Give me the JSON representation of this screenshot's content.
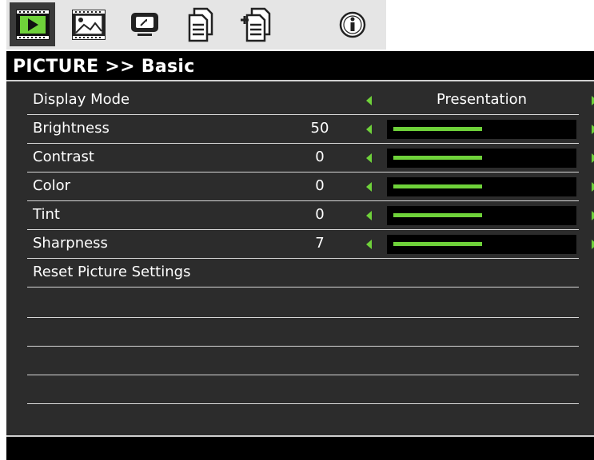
{
  "colors": {
    "accent": "#6fd23a",
    "header_bg": "#000000",
    "panel_bg": "#2c2c2c",
    "tabbar_bg": "#e5e5e5"
  },
  "tabs": [
    {
      "icon": "picture-play-icon",
      "active": true
    },
    {
      "icon": "image-adjust-icon",
      "active": false
    },
    {
      "icon": "display-icon",
      "active": false
    },
    {
      "icon": "document-setup-icon",
      "active": false
    },
    {
      "icon": "document-options-icon",
      "active": false
    },
    {
      "icon": "info-icon",
      "active": false
    }
  ],
  "header": {
    "title": "PICTURE >> Basic"
  },
  "menu": {
    "display_mode": {
      "label": "Display Mode",
      "option": "Presentation"
    },
    "brightness": {
      "label": "Brightness",
      "value": "50",
      "level": 0.5
    },
    "contrast": {
      "label": "Contrast",
      "value": "0",
      "level": 0.5
    },
    "color": {
      "label": "Color",
      "value": "0",
      "level": 0.5
    },
    "tint": {
      "label": "Tint",
      "value": "0",
      "level": 0.5
    },
    "sharpness": {
      "label": "Sharpness",
      "value": "7",
      "level": 0.5
    },
    "reset": {
      "label": "Reset Picture Settings"
    }
  }
}
